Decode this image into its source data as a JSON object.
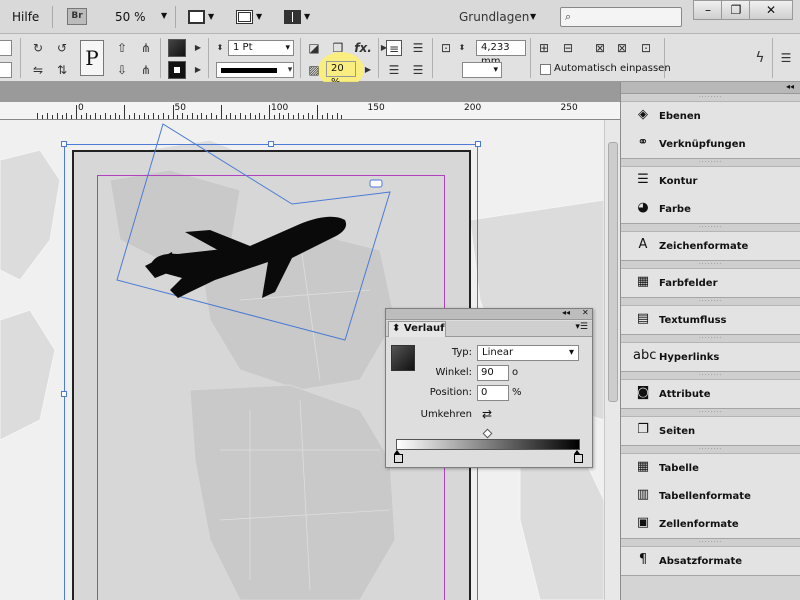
{
  "appbar": {
    "menu_help": "Hilfe",
    "bridge_label": "Br",
    "zoom": "50 %",
    "workspace": "Grundlagen",
    "search_placeholder": "",
    "win_minimize": "–",
    "win_restore": "❐",
    "win_close": "✕"
  },
  "control": {
    "p_glyph": "P",
    "stroke_weight": "1 Pt",
    "opacity": "20 %",
    "fx_label": "fx.",
    "measure": "4,233 mm",
    "auto_fit": "Automatisch einpassen"
  },
  "ruler": {
    "labels": [
      "0",
      "50",
      "100",
      "150",
      "200",
      "250"
    ]
  },
  "verlauf": {
    "title": "Verlauf",
    "type_label": "Typ:",
    "type_value": "Linear",
    "angle_label": "Winkel:",
    "angle_value": "90",
    "angle_unit": "o",
    "position_label": "Position:",
    "position_value": "0",
    "position_unit": "%",
    "reverse_label": "Umkehren"
  },
  "dock": {
    "groups": [
      [
        "Ebenen",
        "Verknüpfungen"
      ],
      [
        "Kontur",
        "Farbe"
      ],
      [
        "Zeichenformate"
      ],
      [
        "Farbfelder"
      ],
      [
        "Textumfluss"
      ],
      [
        "Hyperlinks"
      ],
      [
        "Attribute"
      ],
      [
        "Seiten"
      ],
      [
        "Tabelle",
        "Tabellenformate",
        "Zellenformate"
      ],
      [
        "Absatzformate"
      ]
    ]
  },
  "colors": {
    "selection": "#4b7bd4",
    "margin_guide": "#b040c0",
    "highlight": "#fff06e"
  }
}
